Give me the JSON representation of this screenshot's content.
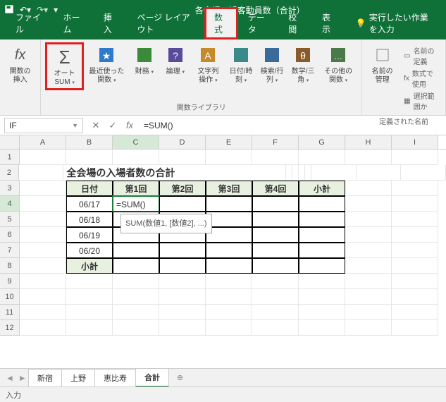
{
  "titlebar": {
    "title": "各会場の観客動員数（合計）"
  },
  "tabs": {
    "file": "ファイル",
    "home": "ホーム",
    "insert": "挿入",
    "pagelayout": "ページ レイアウト",
    "formulas": "数式",
    "data": "データ",
    "review": "校閲",
    "view": "表示",
    "tellme": "実行したい作業を入力"
  },
  "ribbon": {
    "insertfn": "関数の挿入",
    "autosum": "オートSUM",
    "recent": "最近使った関数",
    "financial": "財務",
    "logical": "論理",
    "text": "文字列操作",
    "datetime": "日付/時刻",
    "lookup": "検索/行列",
    "math": "数学/三角",
    "more": "その他の関数",
    "grp_lib": "関数ライブラリ",
    "namemgr": "名前の管理",
    "definename": "名前の定義",
    "useinfm": "数式で使用",
    "createfrom": "選択範囲か",
    "grp_names": "定義された名前"
  },
  "namebox": {
    "value": "IF"
  },
  "formulabar": {
    "value": "=SUM()"
  },
  "sheet": {
    "cols": [
      "A",
      "B",
      "C",
      "D",
      "E",
      "F",
      "G",
      "H",
      "I"
    ],
    "rows": [
      "1",
      "2",
      "3",
      "4",
      "5",
      "6",
      "7",
      "8",
      "9",
      "10",
      "11",
      "12"
    ],
    "title": "全会場の入場者数の合計",
    "hdr": {
      "date": "日付",
      "r1": "第1回",
      "r2": "第2回",
      "r3": "第3回",
      "r4": "第4回",
      "sub": "小計"
    },
    "dates": [
      "06/17",
      "06/18",
      "06/19",
      "06/20"
    ],
    "subtotal": "小計",
    "active_formula": "=SUM()",
    "tooltip": "SUM(数値1, [数値2], ...)"
  },
  "sheettabs": {
    "t1": "新宿",
    "t2": "上野",
    "t3": "恵比寿",
    "t4": "合計"
  },
  "status": {
    "mode": "入力"
  }
}
